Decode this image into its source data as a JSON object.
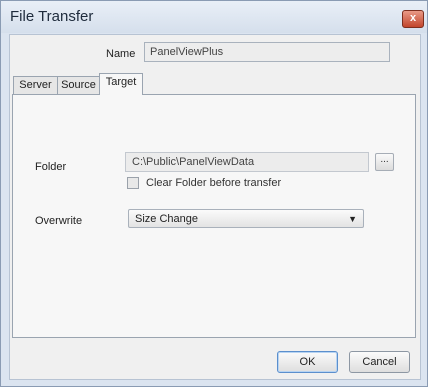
{
  "window": {
    "title": "File Transfer",
    "close_glyph": "x"
  },
  "name": {
    "label": "Name",
    "value": "PanelViewPlus"
  },
  "tabs": [
    {
      "label": "Server"
    },
    {
      "label": "Source"
    },
    {
      "label": "Target",
      "active": true
    }
  ],
  "target": {
    "folder_label": "Folder",
    "folder_value": "C:\\Public\\PanelViewData",
    "browse_label": "...",
    "clear_folder_label": "Clear Folder before transfer",
    "clear_folder_checked": false,
    "overwrite_label": "Overwrite",
    "overwrite_selected": "Size Change"
  },
  "buttons": {
    "ok": "OK",
    "cancel": "Cancel"
  },
  "colors": {
    "titlebar": "#dde6f2",
    "close_button": "#c2452c",
    "dialog_body": "#f0f0f0"
  }
}
